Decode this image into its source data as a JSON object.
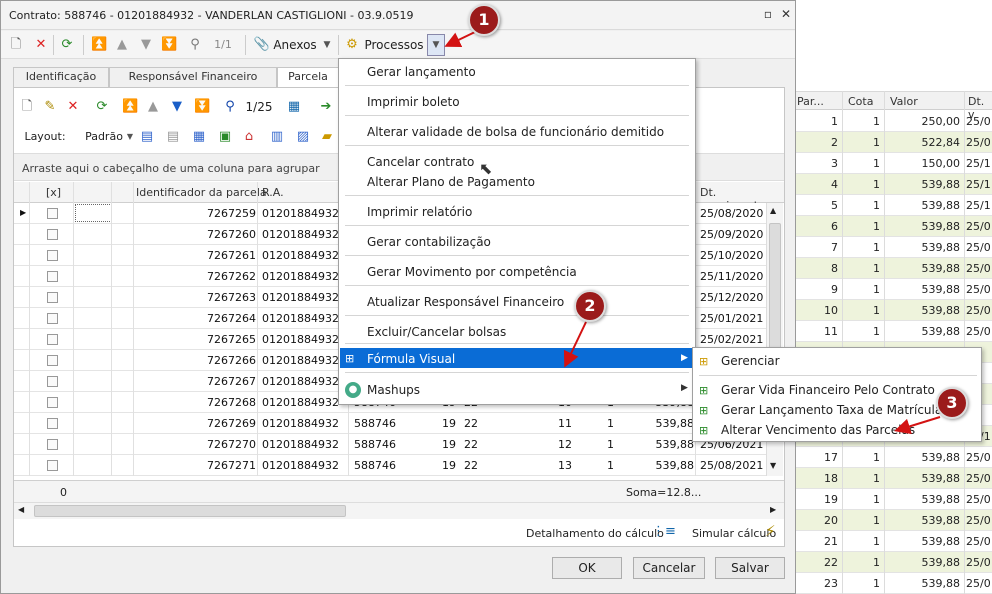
{
  "window": {
    "title": "Contrato: 588746 - 01201884932 - VANDERLAN CASTIGLIONI - 03.9.0519"
  },
  "toolbar": {
    "nav": "1/1",
    "anexos": "Anexos",
    "processos": "Processos"
  },
  "tabs": [
    "Identificação",
    "Responsável Financeiro",
    "Parcela"
  ],
  "subtoolbar": {
    "pager": "1/25"
  },
  "layoutbar": {
    "layout": "Layout:",
    "padrao": "Padrão"
  },
  "grid": {
    "group_hint": "Arraste aqui o cabeçalho de uma coluna para agrupar",
    "columns": {
      "check": "[x]",
      "id": "Identificador da parcela",
      "ra": "R.A.",
      "due": "Dt. vencimento"
    },
    "rows": [
      {
        "id": "7267259",
        "ra": "01201884932",
        "due": "25/08/2020"
      },
      {
        "id": "7267260",
        "ra": "01201884932",
        "due": "25/09/2020"
      },
      {
        "id": "7267261",
        "ra": "01201884932",
        "due": "25/10/2020"
      },
      {
        "id": "7267262",
        "ra": "01201884932",
        "due": "25/11/2020"
      },
      {
        "id": "7267263",
        "ra": "01201884932",
        "due": "25/12/2020"
      },
      {
        "id": "7267264",
        "ra": "01201884932",
        "due": "25/01/2021"
      },
      {
        "id": "7267265",
        "ra": "01201884932",
        "due": "25/02/2021"
      },
      {
        "id": "7267266",
        "ra": "01201884932",
        "due": ""
      },
      {
        "id": "7267267",
        "ra": "01201884932",
        "due": ""
      },
      {
        "id": "7267268",
        "ra": "01201884932",
        "contract": "588746",
        "a": "19",
        "b": "22",
        "parc": "10",
        "cota": "1",
        "val": "539,88",
        "due": ""
      },
      {
        "id": "7267269",
        "ra": "01201884932",
        "contract": "588746",
        "a": "19",
        "b": "22",
        "parc": "11",
        "cota": "1",
        "val": "539,88",
        "due": "25/06/2021"
      },
      {
        "id": "7267270",
        "ra": "01201884932",
        "contract": "588746",
        "a": "19",
        "b": "22",
        "parc": "12",
        "cota": "1",
        "val": "539,88",
        "due": "25/06/2021"
      },
      {
        "id": "7267271",
        "ra": "01201884932",
        "contract": "588746",
        "a": "19",
        "b": "22",
        "parc": "13",
        "cota": "1",
        "val": "539,88",
        "due": "25/08/2021"
      }
    ],
    "footer_count": "0",
    "footer_sum": "Soma=12.8..."
  },
  "bottom": {
    "detalhamento": "Detalhamento do cálculo",
    "simular": "Simular cálculo"
  },
  "buttons": {
    "ok": "OK",
    "cancel": "Cancelar",
    "save": "Salvar"
  },
  "menu": {
    "items": [
      "Gerar lançamento",
      "Imprimir boleto",
      "Alterar validade de bolsa de funcionário demitido",
      "Cancelar contrato",
      "Alterar Plano de Pagamento",
      "Imprimir relatório",
      "Gerar contabilização",
      "Gerar Movimento por competência",
      "Atualizar Responsável Financeiro",
      "Excluir/Cancelar bolsas",
      "Fórmula Visual",
      "Mashups"
    ]
  },
  "submenu": {
    "items": [
      "Gerenciar",
      "Gerar Vida Financeiro Pelo Contrato",
      "Gerar Lançamento Taxa de Matrícula",
      "Alterar Vencimento das Parcelas"
    ]
  },
  "badges": [
    "1",
    "2",
    "3"
  ],
  "background_grid": {
    "columns": [
      "Par...",
      "Cota",
      "Valor",
      "Dt. v"
    ],
    "rows": [
      [
        "1",
        "1",
        "250,00",
        "25/0"
      ],
      [
        "2",
        "1",
        "522,84",
        "25/0"
      ],
      [
        "3",
        "1",
        "150,00",
        "25/1"
      ],
      [
        "4",
        "1",
        "539,88",
        "25/1"
      ],
      [
        "5",
        "1",
        "539,88",
        "25/1"
      ],
      [
        "6",
        "1",
        "539,88",
        "25/0"
      ],
      [
        "7",
        "1",
        "539,88",
        "25/0"
      ],
      [
        "8",
        "1",
        "539,88",
        "25/0"
      ],
      [
        "9",
        "1",
        "539,88",
        "25/0"
      ],
      [
        "10",
        "1",
        "539,88",
        "25/0"
      ],
      [
        "11",
        "1",
        "539,88",
        "25/0"
      ],
      [
        "",
        "",
        "",
        "/1"
      ],
      [
        "",
        "",
        "",
        "/1"
      ],
      [
        "",
        "",
        "",
        "/1"
      ],
      [
        "",
        "",
        "",
        "/1"
      ],
      [
        "",
        "",
        "",
        "25/1"
      ],
      [
        "17",
        "1",
        "539,88",
        "25/0"
      ],
      [
        "18",
        "1",
        "539,88",
        "25/0"
      ],
      [
        "19",
        "1",
        "539,88",
        "25/0"
      ],
      [
        "20",
        "1",
        "539,88",
        "25/0"
      ],
      [
        "21",
        "1",
        "539,88",
        "25/0"
      ],
      [
        "22",
        "1",
        "539,88",
        "25/0"
      ],
      [
        "23",
        "1",
        "539,88",
        "25/0"
      ]
    ]
  },
  "colors": {
    "highlight": "#0a6cd6",
    "badge": "#9b1b1b",
    "row_alt": "#eef3dc"
  }
}
